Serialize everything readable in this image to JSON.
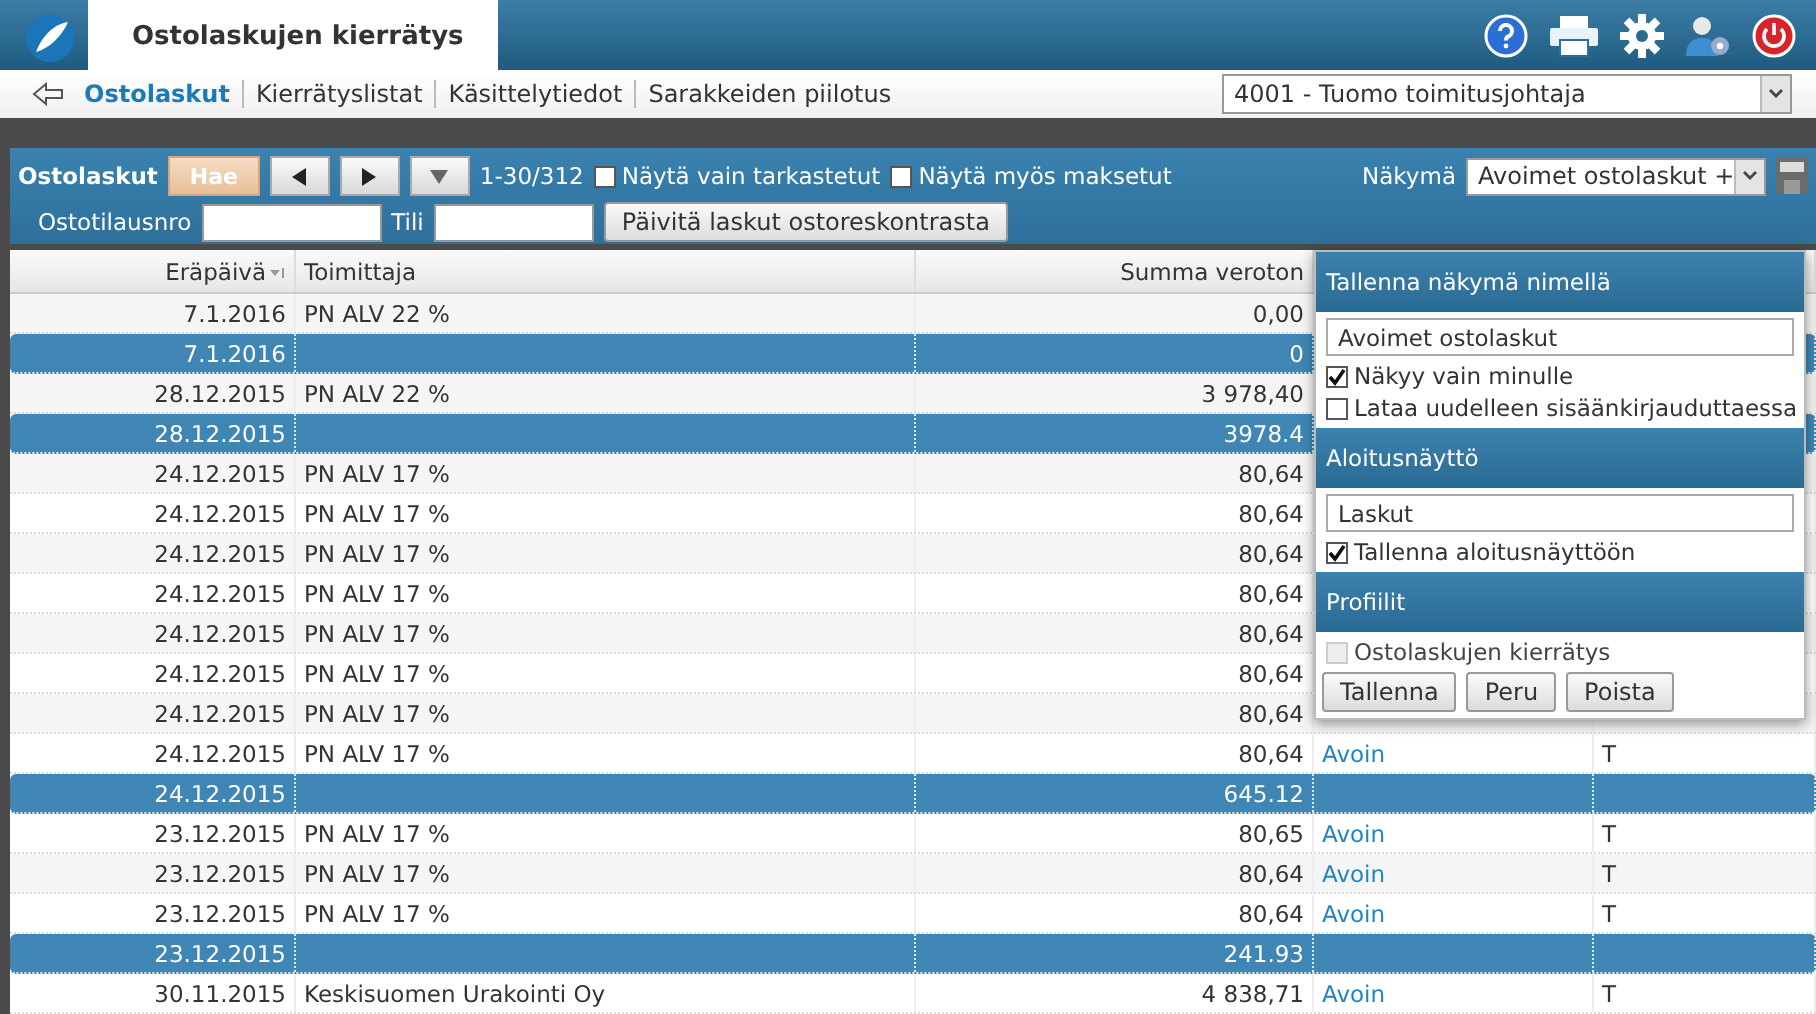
{
  "app": {
    "title": "Ostolaskujen kierrätys"
  },
  "nav": {
    "items": [
      {
        "label": "Ostolaskut",
        "selected": true
      },
      {
        "label": "Kierrätyslistat",
        "selected": false
      },
      {
        "label": "Käsittelytiedot",
        "selected": false
      },
      {
        "label": "Sarakkeiden piilotus",
        "selected": false
      }
    ],
    "user_select": {
      "value": "4001 - Tuomo toimitusjohtaja"
    }
  },
  "toolbar": {
    "title": "Ostolaskut",
    "search_button": "Hae",
    "range": "1-30/312",
    "checkboxes": [
      {
        "label": "Näytä vain tarkastetut",
        "checked": false
      },
      {
        "label": "Näytä myös maksetut",
        "checked": false
      }
    ],
    "view_label": "Näkymä",
    "view_select": "Avoimet ostolaskut +",
    "order_label": "Ostotilausnro",
    "account_label": "Tili",
    "update_button": "Päivitä laskut ostoreskontrasta"
  },
  "table": {
    "columns": [
      {
        "label": "Eräpäivä",
        "sorted": true
      },
      {
        "label": "Toimittaja",
        "sorted": false
      },
      {
        "label": "Summa veroton",
        "sorted": false
      }
    ],
    "rows": [
      {
        "kind": "item",
        "date": "7.1.2016",
        "supplier": "PN ALV 22 %",
        "amount": "0,00"
      },
      {
        "kind": "group",
        "date": "7.1.2016",
        "amount": "0"
      },
      {
        "kind": "item",
        "date": "28.12.2015",
        "supplier": "PN ALV 22 %",
        "amount": "3 978,40"
      },
      {
        "kind": "group",
        "date": "28.12.2015",
        "amount": "3978.4"
      },
      {
        "kind": "item",
        "date": "24.12.2015",
        "supplier": "PN ALV 17 %",
        "amount": "80,64"
      },
      {
        "kind": "item",
        "date": "24.12.2015",
        "supplier": "PN ALV 17 %",
        "amount": "80,64"
      },
      {
        "kind": "item",
        "date": "24.12.2015",
        "supplier": "PN ALV 17 %",
        "amount": "80,64"
      },
      {
        "kind": "item",
        "date": "24.12.2015",
        "supplier": "PN ALV 17 %",
        "amount": "80,64"
      },
      {
        "kind": "item",
        "date": "24.12.2015",
        "supplier": "PN ALV 17 %",
        "amount": "80,64"
      },
      {
        "kind": "item",
        "date": "24.12.2015",
        "supplier": "PN ALV 17 %",
        "amount": "80,64"
      },
      {
        "kind": "item",
        "date": "24.12.2015",
        "supplier": "PN ALV 17 %",
        "amount": "80,64"
      },
      {
        "kind": "item",
        "date": "24.12.2015",
        "supplier": "PN ALV 17 %",
        "amount": "80,64",
        "status": "Avoin",
        "code": "T"
      },
      {
        "kind": "group",
        "date": "24.12.2015",
        "amount": "645.12"
      },
      {
        "kind": "item",
        "date": "23.12.2015",
        "supplier": "PN ALV 17 %",
        "amount": "80,65",
        "status": "Avoin",
        "code": "T"
      },
      {
        "kind": "item",
        "date": "23.12.2015",
        "supplier": "PN ALV 17 %",
        "amount": "80,64",
        "status": "Avoin",
        "code": "T"
      },
      {
        "kind": "item",
        "date": "23.12.2015",
        "supplier": "PN ALV 17 %",
        "amount": "80,64",
        "status": "Avoin",
        "code": "T"
      },
      {
        "kind": "group",
        "date": "23.12.2015",
        "amount": "241.93"
      },
      {
        "kind": "item",
        "date": "30.11.2015",
        "supplier": "Keskisuomen Urakointi Oy",
        "amount": "4 838,71",
        "status": "Avoin",
        "code": "T"
      }
    ]
  },
  "view_popup": {
    "sections": [
      {
        "title": "Tallenna näkymä nimellä",
        "field": "Avoimet ostolaskut",
        "checkboxes": [
          {
            "label": "Näkyy vain minulle",
            "checked": true,
            "disabled": false
          },
          {
            "label": "Lataa uudelleen sisäänkirjauduttaessa",
            "checked": false,
            "disabled": false
          }
        ]
      },
      {
        "title": "Aloitusnäyttö",
        "field": "Laskut",
        "checkboxes": [
          {
            "label": "Tallenna aloitusnäyttöön",
            "checked": true,
            "disabled": false
          }
        ]
      },
      {
        "title": "Profiilit",
        "checkboxes": [
          {
            "label": "Ostolaskujen kierrätys",
            "checked": false,
            "disabled": true
          }
        ]
      }
    ],
    "buttons": [
      "Tallenna",
      "Peru",
      "Poista"
    ]
  }
}
